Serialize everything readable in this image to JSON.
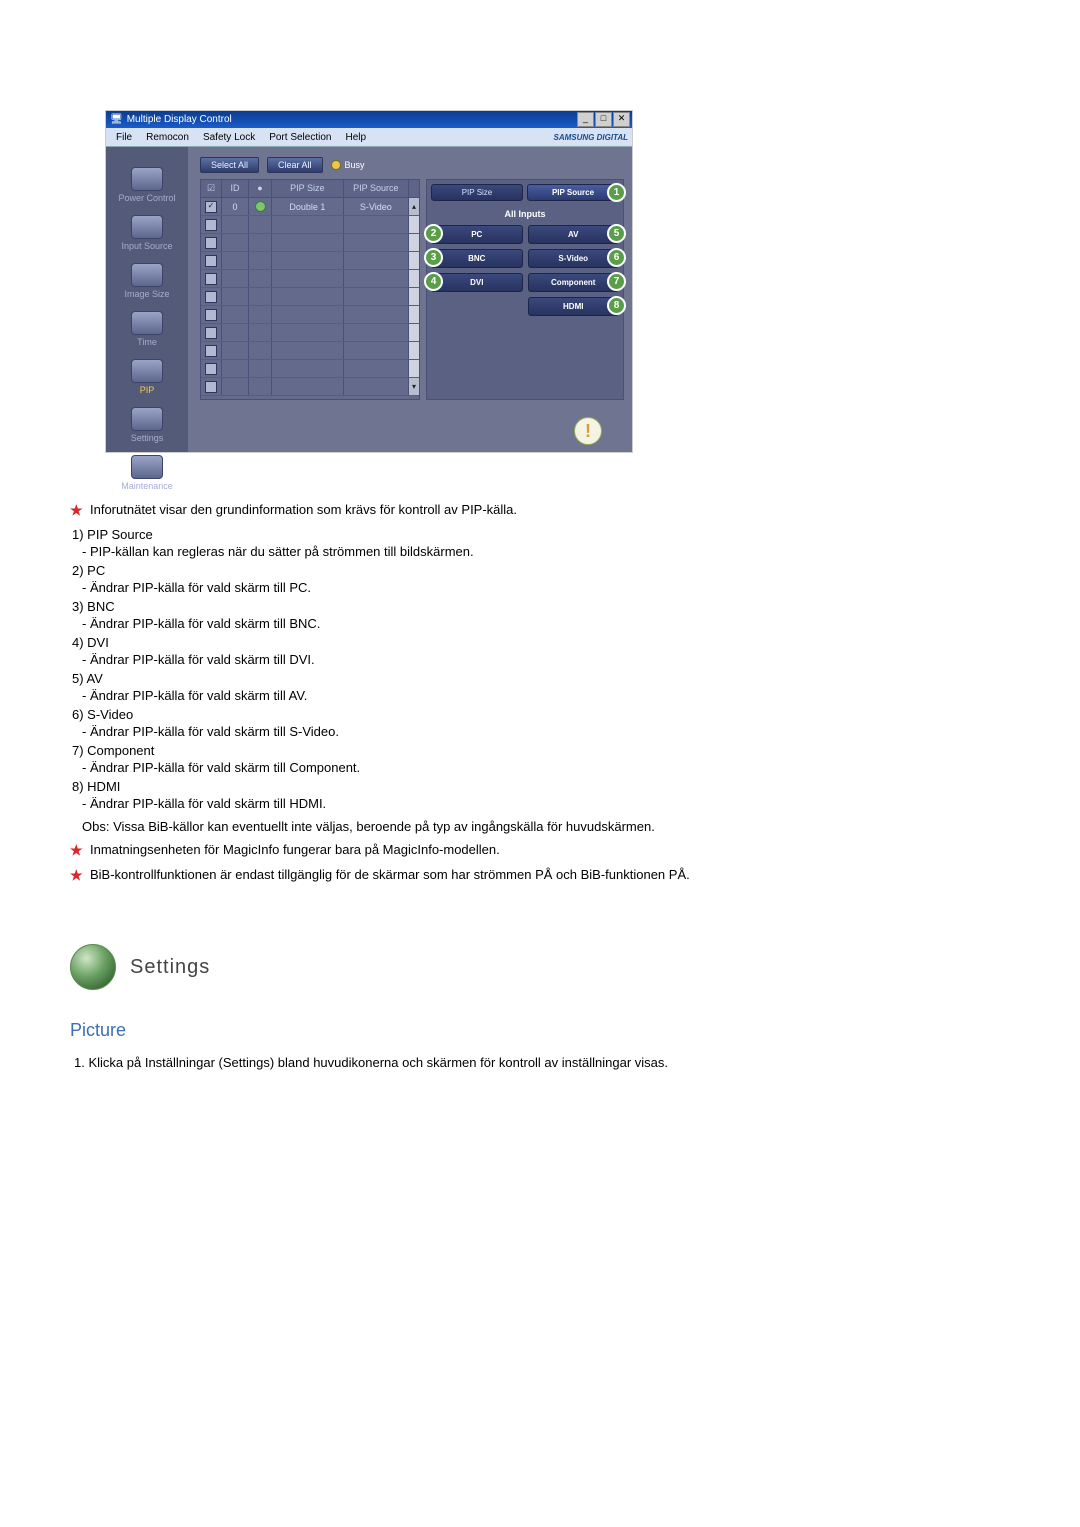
{
  "app": {
    "title": "Multiple Display Control",
    "menus": [
      "File",
      "Remocon",
      "Safety Lock",
      "Port Selection",
      "Help"
    ],
    "brand": "SAMSUNG DIGITAL"
  },
  "sidebar": {
    "items": [
      {
        "label": "Power Control"
      },
      {
        "label": "Input Source"
      },
      {
        "label": "Image Size"
      },
      {
        "label": "Time"
      },
      {
        "label": "PIP"
      },
      {
        "label": "Settings"
      },
      {
        "label": "Maintenance"
      }
    ],
    "active_index": 4
  },
  "toolbar": {
    "select_all": "Select All",
    "clear_all": "Clear All",
    "busy": "Busy"
  },
  "grid": {
    "headers": {
      "chk": "",
      "id": "ID",
      "status": "",
      "size": "PIP Size",
      "source": "PIP Source"
    },
    "rows": [
      {
        "checked": true,
        "id": "0",
        "status": "on",
        "size": "Double 1",
        "source": "S-Video"
      },
      {
        "checked": false
      },
      {
        "checked": false
      },
      {
        "checked": false
      },
      {
        "checked": false
      },
      {
        "checked": false
      },
      {
        "checked": false
      },
      {
        "checked": false
      },
      {
        "checked": false
      },
      {
        "checked": false
      },
      {
        "checked": false
      }
    ]
  },
  "right": {
    "top": {
      "size": "PIP Size",
      "source": "PIP Source"
    },
    "section_label": "All Inputs",
    "buttons": {
      "pc": "PC",
      "av": "AV",
      "bnc": "BNC",
      "svideo": "S-Video",
      "dvi": "DVI",
      "component": "Component",
      "hdmi": "HDMI"
    },
    "callouts": {
      "source": "1",
      "pc": "2",
      "bnc": "3",
      "dvi": "4",
      "av": "5",
      "svideo": "6",
      "component": "7",
      "hdmi": "8"
    }
  },
  "text": {
    "star1": "Inforutnätet visar den grundinformation som krävs för kontroll av PIP-källa.",
    "items": [
      {
        "n": "1)",
        "t": "PIP Source",
        "d": "- PIP-källan kan regleras när du sätter på strömmen till bildskärmen."
      },
      {
        "n": "2)",
        "t": "PC",
        "d": "- Ändrar PIP-källa för vald skärm till PC."
      },
      {
        "n": "3)",
        "t": "BNC",
        "d": "- Ändrar PIP-källa för vald skärm till BNC."
      },
      {
        "n": "4)",
        "t": "DVI",
        "d": "- Ändrar PIP-källa för vald skärm till DVI."
      },
      {
        "n": "5)",
        "t": "AV",
        "d": "- Ändrar PIP-källa för vald skärm till AV."
      },
      {
        "n": "6)",
        "t": "S-Video",
        "d": "- Ändrar PIP-källa för vald skärm till S-Video."
      },
      {
        "n": "7)",
        "t": "Component",
        "d": "- Ändrar PIP-källa för vald skärm till Component."
      },
      {
        "n": "8)",
        "t": "HDMI",
        "d": "- Ändrar PIP-källa för vald skärm till HDMI."
      }
    ],
    "obs": "Obs: Vissa BiB-källor kan eventuellt inte väljas, beroende på typ av ingångskälla för huvudskärmen.",
    "star2": "Inmatningsenheten för MagicInfo fungerar bara på MagicInfo-modellen.",
    "star3": "BiB-kontrollfunktionen är endast tillgänglig för de skärmar som har strömmen PÅ och BiB-funktionen PÅ.",
    "section": "Settings",
    "subsection": "Picture",
    "instr_prefix": "1. ",
    "instr": "Klicka på Inställningar (Settings) bland huvudikonerna och skärmen för kontroll av inställningar visas."
  }
}
